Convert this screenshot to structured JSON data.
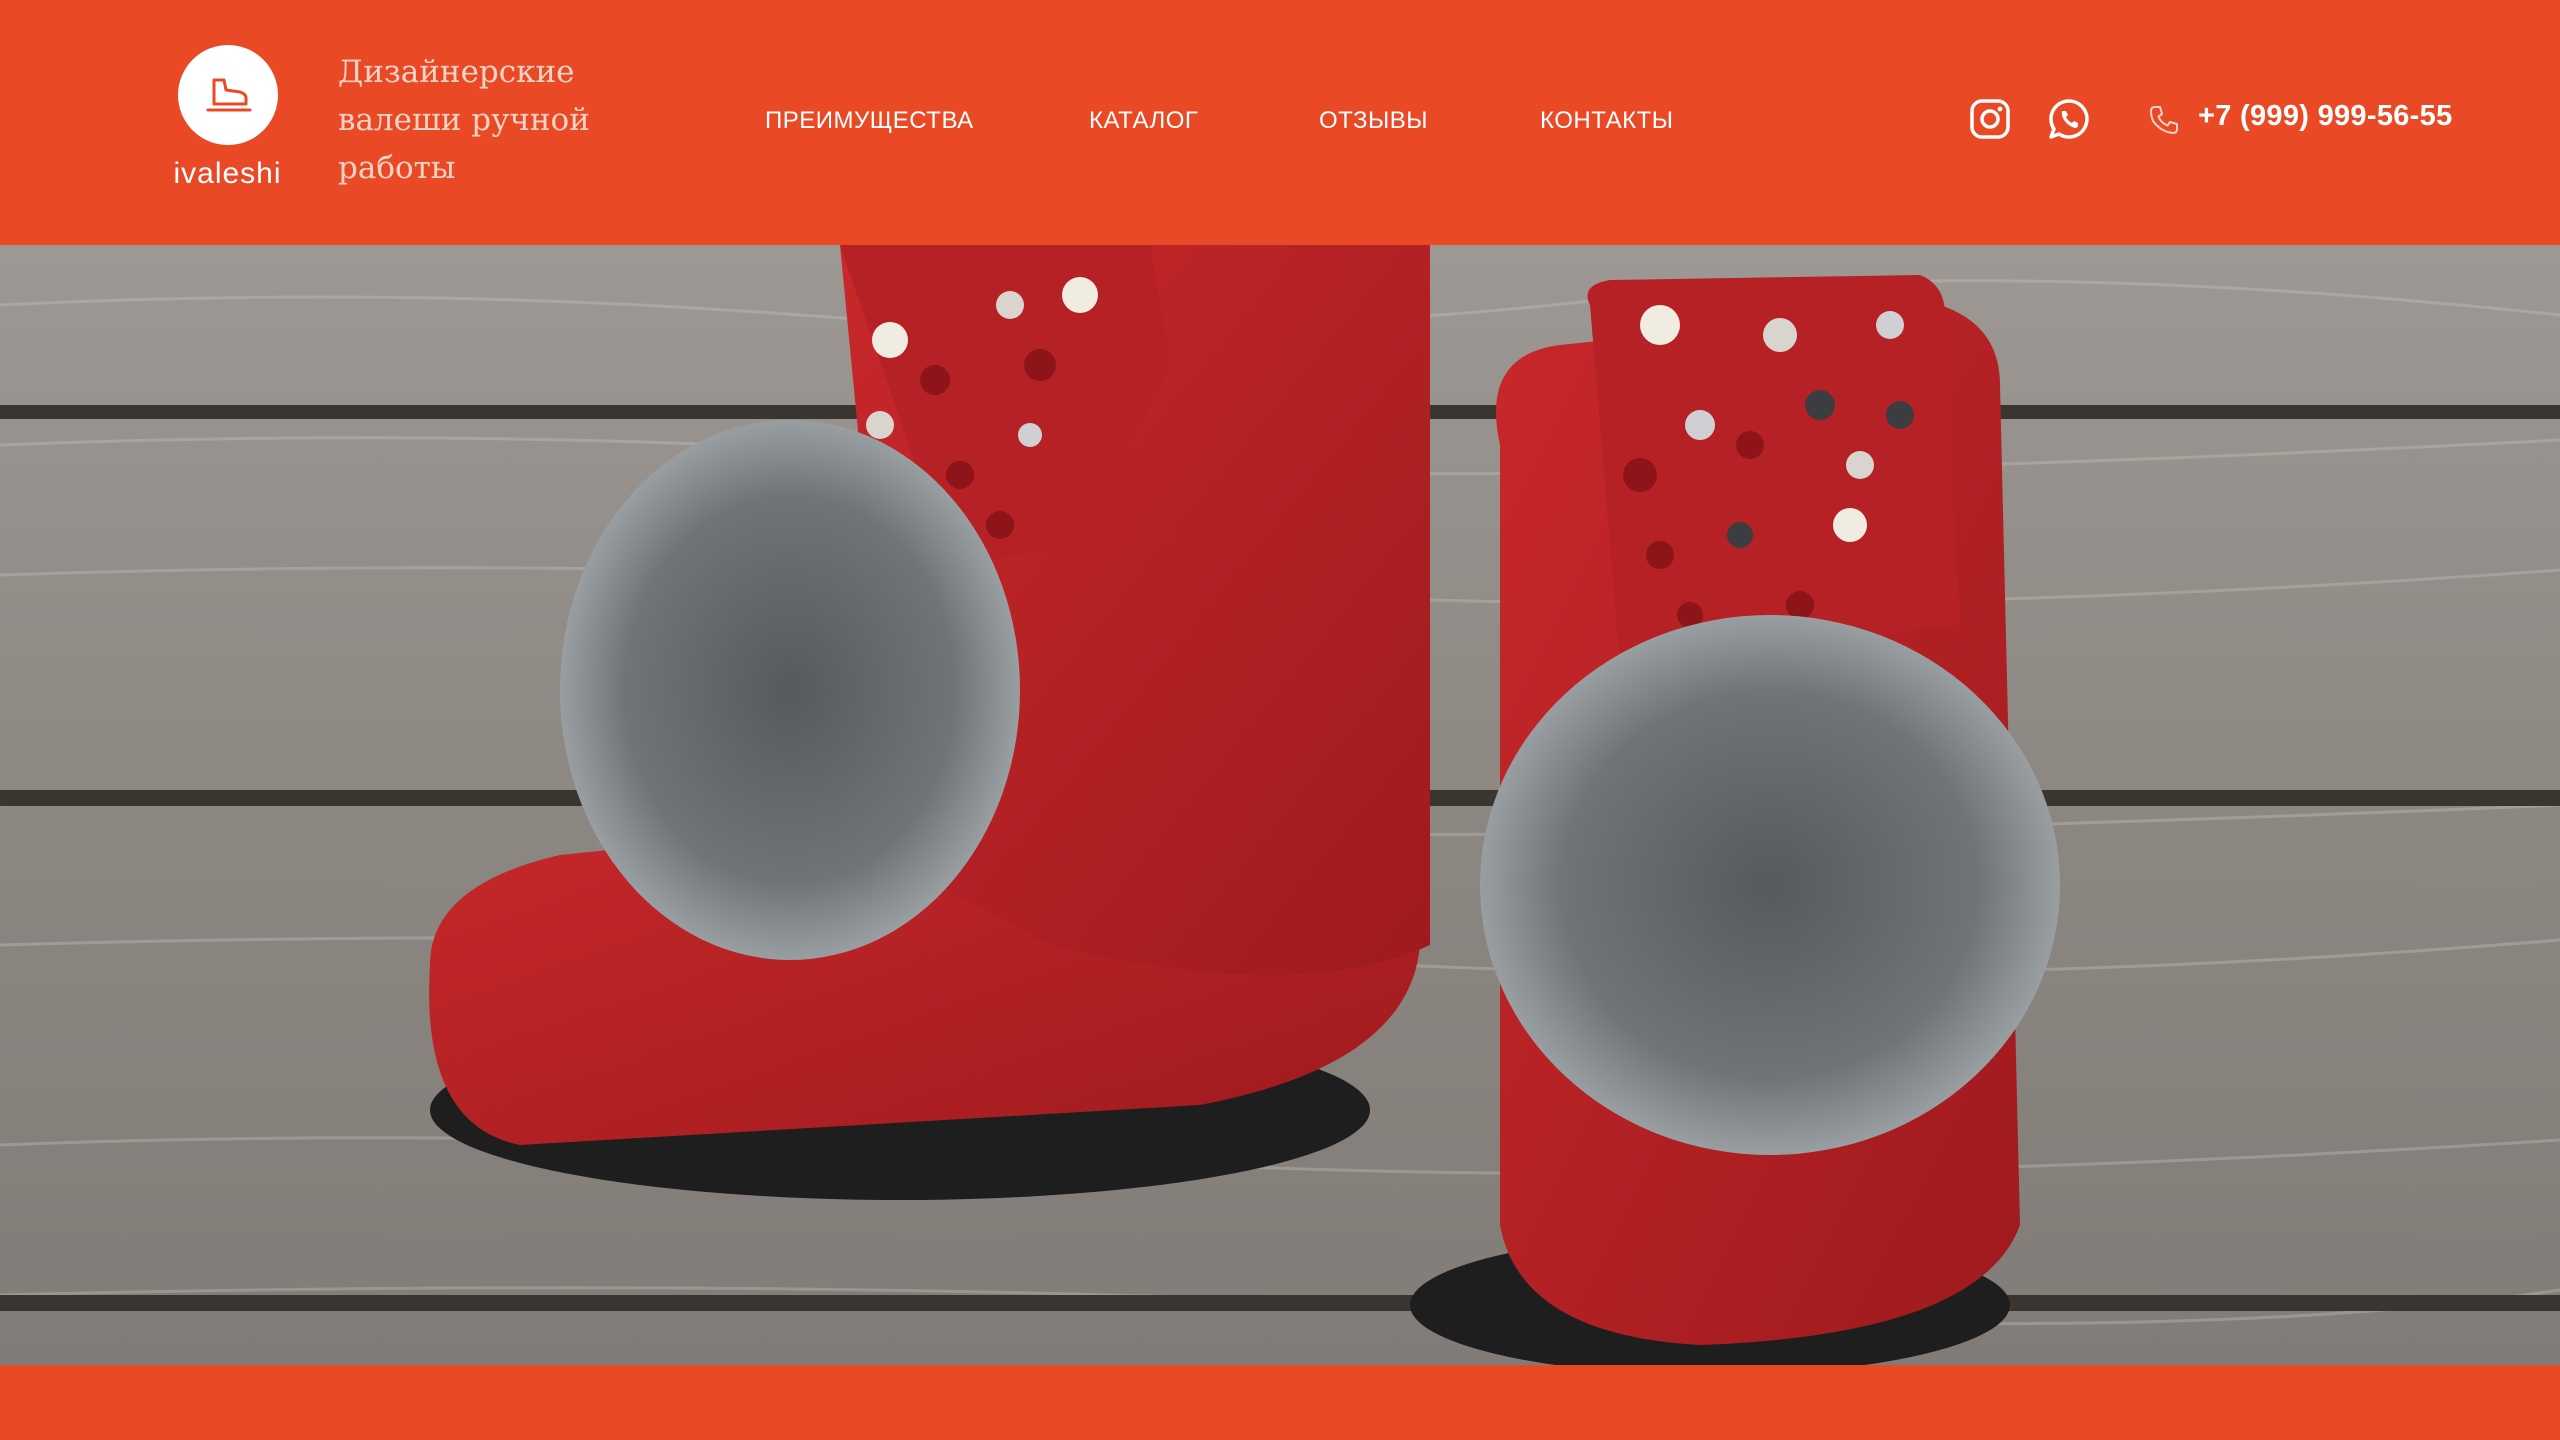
{
  "header": {
    "logo_text": "ivaleshi",
    "tagline": "Дизайнерские валеши ручной работы",
    "nav": [
      {
        "label": "ПРЕИМУЩЕСТВА"
      },
      {
        "label": "КАТАЛОГ"
      },
      {
        "label": "ОТЗЫВЫ"
      },
      {
        "label": "КОНТАКТЫ"
      }
    ],
    "social": [
      {
        "icon": "instagram-icon"
      },
      {
        "icon": "whatsapp-icon"
      }
    ],
    "phone_icon": "phone-icon",
    "phone": "+7 (999) 999-56-55"
  },
  "hero": {
    "image": "photo of red felt boots with grey fur pompoms on wooden boards"
  },
  "colors": {
    "brand": "#e94a25",
    "text": "#ffffff",
    "tagline": "#f5d3c6"
  }
}
